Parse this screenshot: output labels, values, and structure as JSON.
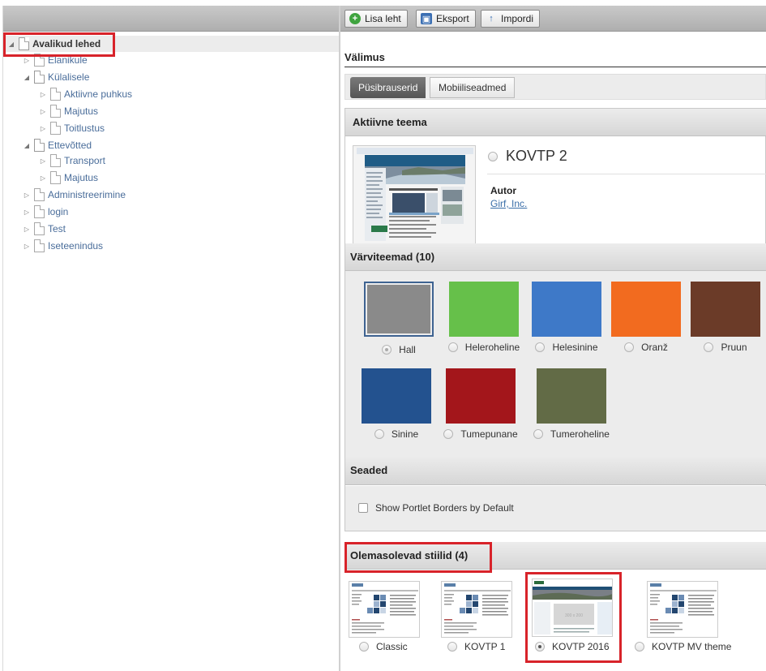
{
  "toolbar": {
    "add_page_label": "Lisa leht",
    "export_label": "Eksport",
    "import_label": "Impordi"
  },
  "tree": {
    "root_label": "Avalikud lehed",
    "items": [
      {
        "label": "Elanikule"
      },
      {
        "label": "Külalisele"
      },
      {
        "label": "Aktiivne puhkus"
      },
      {
        "label": "Majutus"
      },
      {
        "label": "Toitlustus"
      },
      {
        "label": "Ettevõtted"
      },
      {
        "label": "Transport"
      },
      {
        "label": "Majutus"
      },
      {
        "label": "Administreerimine"
      },
      {
        "label": "login"
      },
      {
        "label": "Test"
      },
      {
        "label": "Iseteenindus"
      }
    ]
  },
  "appearance": {
    "section_title": "Välimus",
    "tabs": [
      {
        "label": "Püsibrauserid",
        "active": true
      },
      {
        "label": "Mobiiliseadmed",
        "active": false
      }
    ],
    "active_theme": {
      "heading": "Aktiivne teema",
      "name": "KOVTP 2",
      "author_label": "Autor",
      "author_name": "Girf, Inc."
    },
    "color_schemes": {
      "heading": "Värviteemad (10)",
      "items": [
        {
          "label": "Hall",
          "color": "#8a8a8a",
          "selected": true
        },
        {
          "label": "Heleroheline",
          "color": "#66c04a",
          "selected": false
        },
        {
          "label": "Helesinine",
          "color": "#3e79c8",
          "selected": false
        },
        {
          "label": "Oranž",
          "color": "#f26b1f",
          "selected": false
        },
        {
          "label": "Pruun",
          "color": "#6b3b28",
          "selected": false
        },
        {
          "label": "Sinine",
          "color": "#23528f",
          "selected": false
        },
        {
          "label": "Tumepunane",
          "color": "#a3161b",
          "selected": false
        },
        {
          "label": "Tumeroheline",
          "color": "#626b46",
          "selected": false
        }
      ]
    },
    "settings": {
      "heading": "Seaded",
      "portlet_borders_label": "Show Portlet Borders by Default"
    },
    "available_styles": {
      "heading": "Olemasolevad stiilid (4)",
      "items": [
        {
          "label": "Classic",
          "selected": false
        },
        {
          "label": "KOVTP 1",
          "selected": false
        },
        {
          "label": "KOVTP 2016",
          "selected": true
        },
        {
          "label": "KOVTP MV theme",
          "selected": false
        }
      ]
    }
  }
}
